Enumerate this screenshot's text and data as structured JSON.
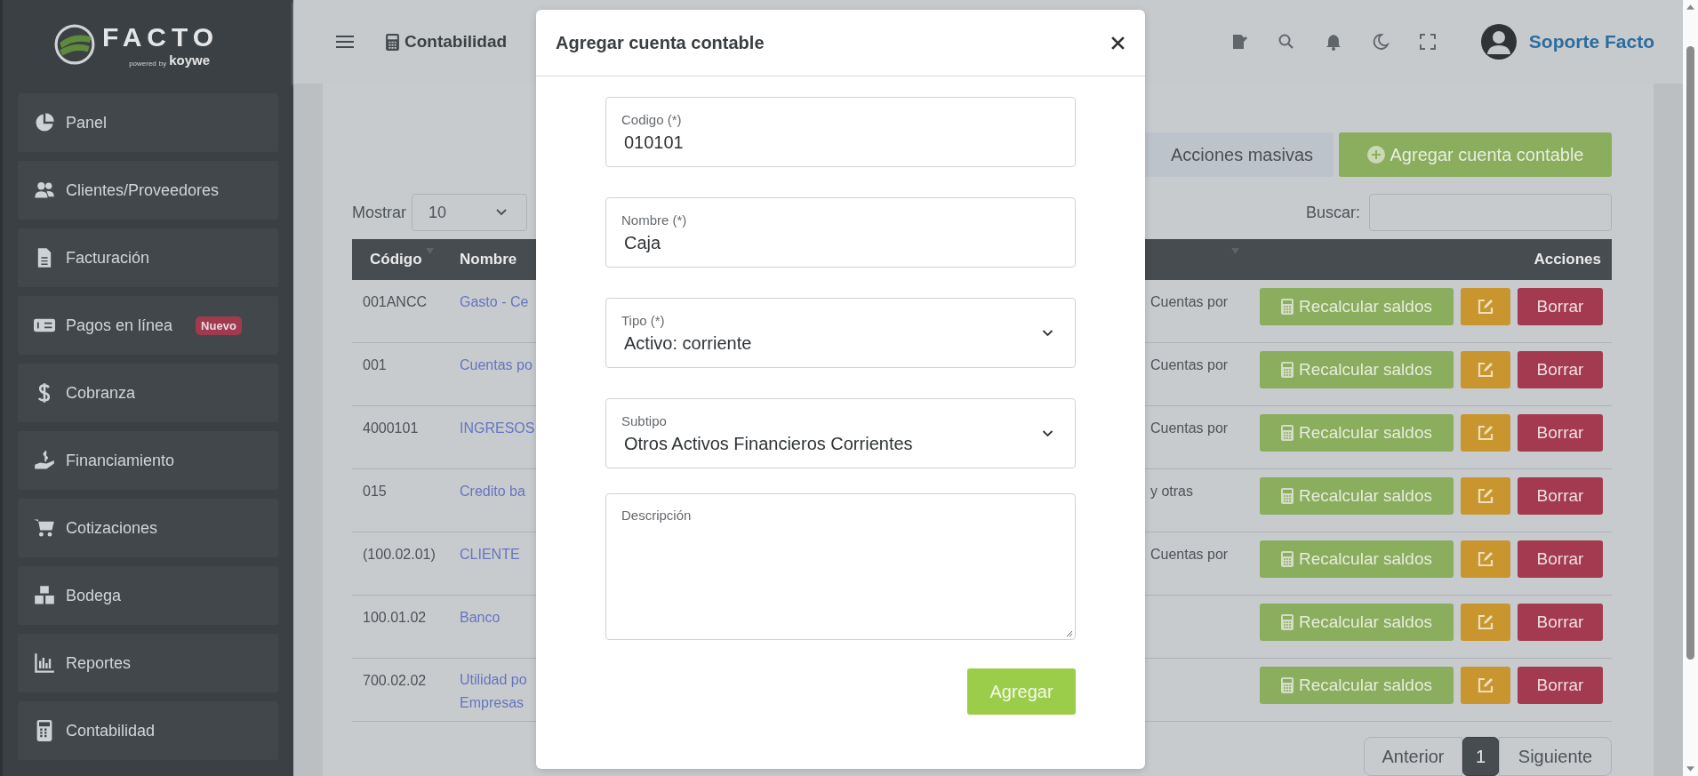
{
  "logo": {
    "name": "FACTO",
    "powered": "powered",
    "by": "by",
    "brand": "koywe"
  },
  "sidebar": {
    "items": [
      {
        "label": "Panel"
      },
      {
        "label": "Clientes/Proveedores"
      },
      {
        "label": "Facturación"
      },
      {
        "label": "Pagos en línea",
        "badge": "Nuevo"
      },
      {
        "label": "Cobranza"
      },
      {
        "label": "Financiamiento"
      },
      {
        "label": "Cotizaciones"
      },
      {
        "label": "Bodega"
      },
      {
        "label": "Reportes"
      },
      {
        "label": "Contabilidad"
      }
    ]
  },
  "topbar": {
    "module": "Contabilidad",
    "user": "Soporte Facto"
  },
  "toolbar": {
    "bulk_actions": "Acciones masivas",
    "add_button": "Agregar cuenta contable",
    "show_label": "Mostrar",
    "page_size": "10",
    "search_label": "Buscar:"
  },
  "table": {
    "columns": [
      {
        "label": "Código",
        "sortable": true
      },
      {
        "label": "Nombre",
        "sortable": false
      },
      {
        "sortable": true
      },
      {
        "label": "Acciones",
        "sortable": false
      }
    ],
    "rows": [
      {
        "code": "001ANCC",
        "name": "Gasto - Ce",
        "column_3": "Cuentas por",
        "recalc": "Recalcular saldos",
        "delete": "Borrar"
      },
      {
        "code": "001",
        "name": "Cuentas po",
        "column_3": "Cuentas por",
        "recalc": "Recalcular saldos",
        "delete": "Borrar"
      },
      {
        "code": "4000101",
        "name": "INGRESOS",
        "column_3": "Cuentas por",
        "recalc": "Recalcular saldos",
        "delete": "Borrar"
      },
      {
        "code": "015",
        "name": "Credito ba",
        "column_3": "y otras",
        "recalc": "Recalcular saldos",
        "delete": "Borrar"
      },
      {
        "code": "(100.02.01)",
        "name": "CLIENTE",
        "column_3": "Cuentas por",
        "recalc": "Recalcular saldos",
        "delete": "Borrar"
      },
      {
        "code": "100.01.02",
        "name": "Banco",
        "recalc": "Recalcular saldos",
        "delete": "Borrar"
      },
      {
        "code": "700.02.02",
        "name": "Utilidad po Empresas",
        "recalc": "Recalcular saldos",
        "delete": "Borrar"
      }
    ]
  },
  "pagination": {
    "prev": "Anterior",
    "pages": [
      {
        "label": "1",
        "selected": true
      }
    ],
    "next": "Siguiente"
  },
  "modal": {
    "title": "Agregar cuenta contable",
    "fields": [
      {
        "kind": "input",
        "label": "Codigo (*)",
        "value": "010101"
      },
      {
        "kind": "input",
        "label": "Nombre (*)",
        "value": "Caja"
      },
      {
        "kind": "select",
        "label": "Tipo (*)",
        "value": "Activo: corriente"
      },
      {
        "kind": "select",
        "label": "Subtipo",
        "value": "Otros Activos Financieros Corrientes"
      },
      {
        "kind": "textarea",
        "label": "Descripción"
      }
    ],
    "submit": "Agregar"
  }
}
